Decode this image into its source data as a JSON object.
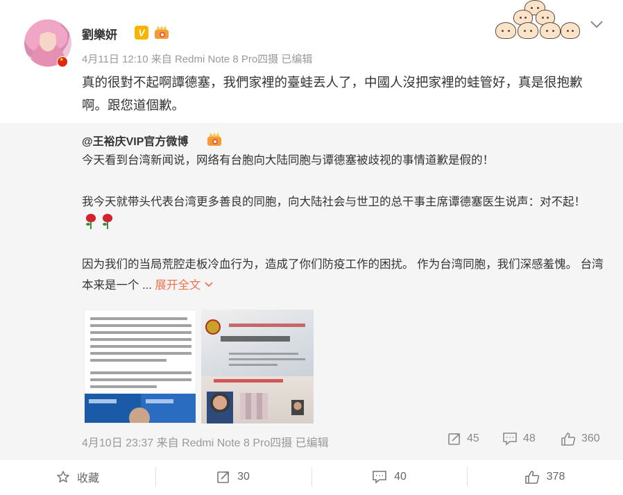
{
  "post": {
    "username": "劉樂妍",
    "vip_mark": "V",
    "meta": "4月11日 12:10 来自 Redmi Note 8 Pro四摄   已编辑",
    "text": "真的很對不起啊譚德塞，我們家裡的臺蛙丟人了，中國人沒把家裡的蛙管好，真是很抱歉啊。跟您道個歉。"
  },
  "repost": {
    "username": "@王裕庆VIP官方微博",
    "paragraph1": "今天看到台湾新闻说，网络有台胞向大陆同胞与谭德塞被歧视的事情道歉是假的！",
    "paragraph2": "我今天就带头代表台湾更多善良的同胞，向大陆社会与世卫的总干事主席谭德塞医生说声：对不起！",
    "paragraph3_text": "因为我们的当局荒腔走板冷血行为，造成了你们防疫工作的困扰。 作为台湾同胞，我们深感羞愧。 台湾本来是一个 ... ",
    "expand_label": "展开全文",
    "meta": "4月10日 23:37 来自 Redmi Note 8 Pro四摄   已编辑",
    "shares": "45",
    "comments": "48",
    "likes": "360"
  },
  "footer": {
    "favorite_label": "收藏",
    "share_count": "30",
    "comment_count": "40",
    "like_count": "378"
  },
  "colors": {
    "link": "#eb7350",
    "repost_bg": "#f5f5f5",
    "vip_gold": "#f7b500"
  },
  "icons": [
    "chevron-down-icon",
    "share-icon",
    "comment-icon",
    "like-icon",
    "star-icon",
    "rose-icon",
    "crown-badge-icon",
    "vip-badge-icon"
  ]
}
